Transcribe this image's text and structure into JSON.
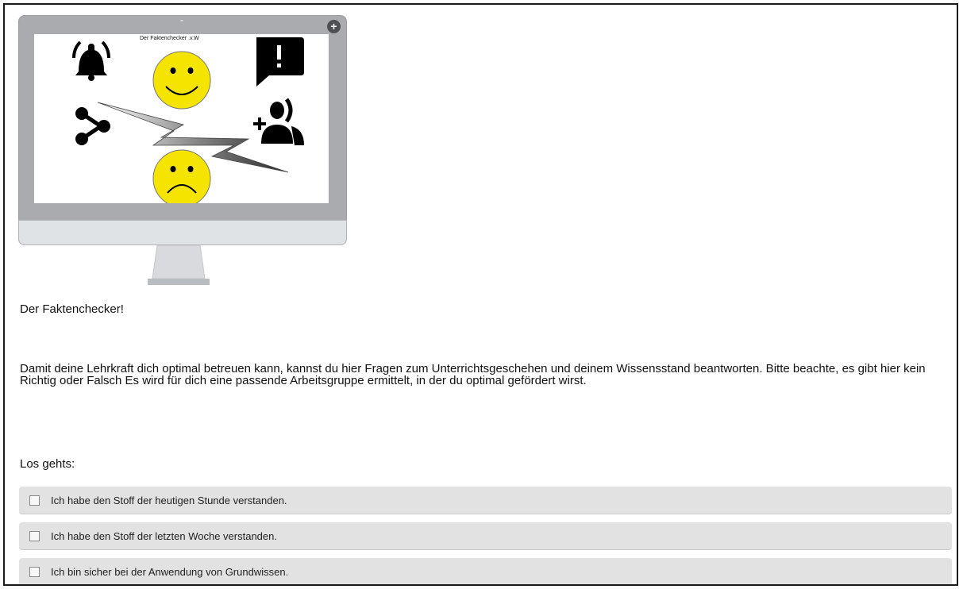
{
  "monitor": {
    "screen_caption": "Der Faktenchecker .v.W",
    "plus_badge": "+",
    "icons": [
      "bell-icon",
      "alert-bubble-icon",
      "share-icon",
      "add-person-icon",
      "lightning-icon",
      "happy-smiley-icon",
      "sad-smiley-icon"
    ]
  },
  "content": {
    "title": "Der Faktenchecker!",
    "intro": "Damit deine Lehrkraft dich optimal betreuen kann, kannst du hier Fragen zum Unterrichtsgeschehen und deinem Wissensstand beantworten. Bitte beachte, es gibt hier kein Richtig oder Falsch Es wird für dich eine passende Arbeitsgruppe ermittelt, in der du optimal gefördert wirst.",
    "lets_go": "Los gehts:"
  },
  "options": [
    {
      "label": "Ich habe den Stoff der heutigen Stunde verstanden.",
      "checked": false
    },
    {
      "label": "Ich habe den Stoff der letzten Woche verstanden.",
      "checked": false
    },
    {
      "label": "Ich bin sicher bei der Anwendung von Grundwissen.",
      "checked": false
    }
  ],
  "colors": {
    "smiley_yellow": "#f5e400",
    "row_background": "#e2e2e2",
    "monitor_gray": "#a9abaf"
  }
}
